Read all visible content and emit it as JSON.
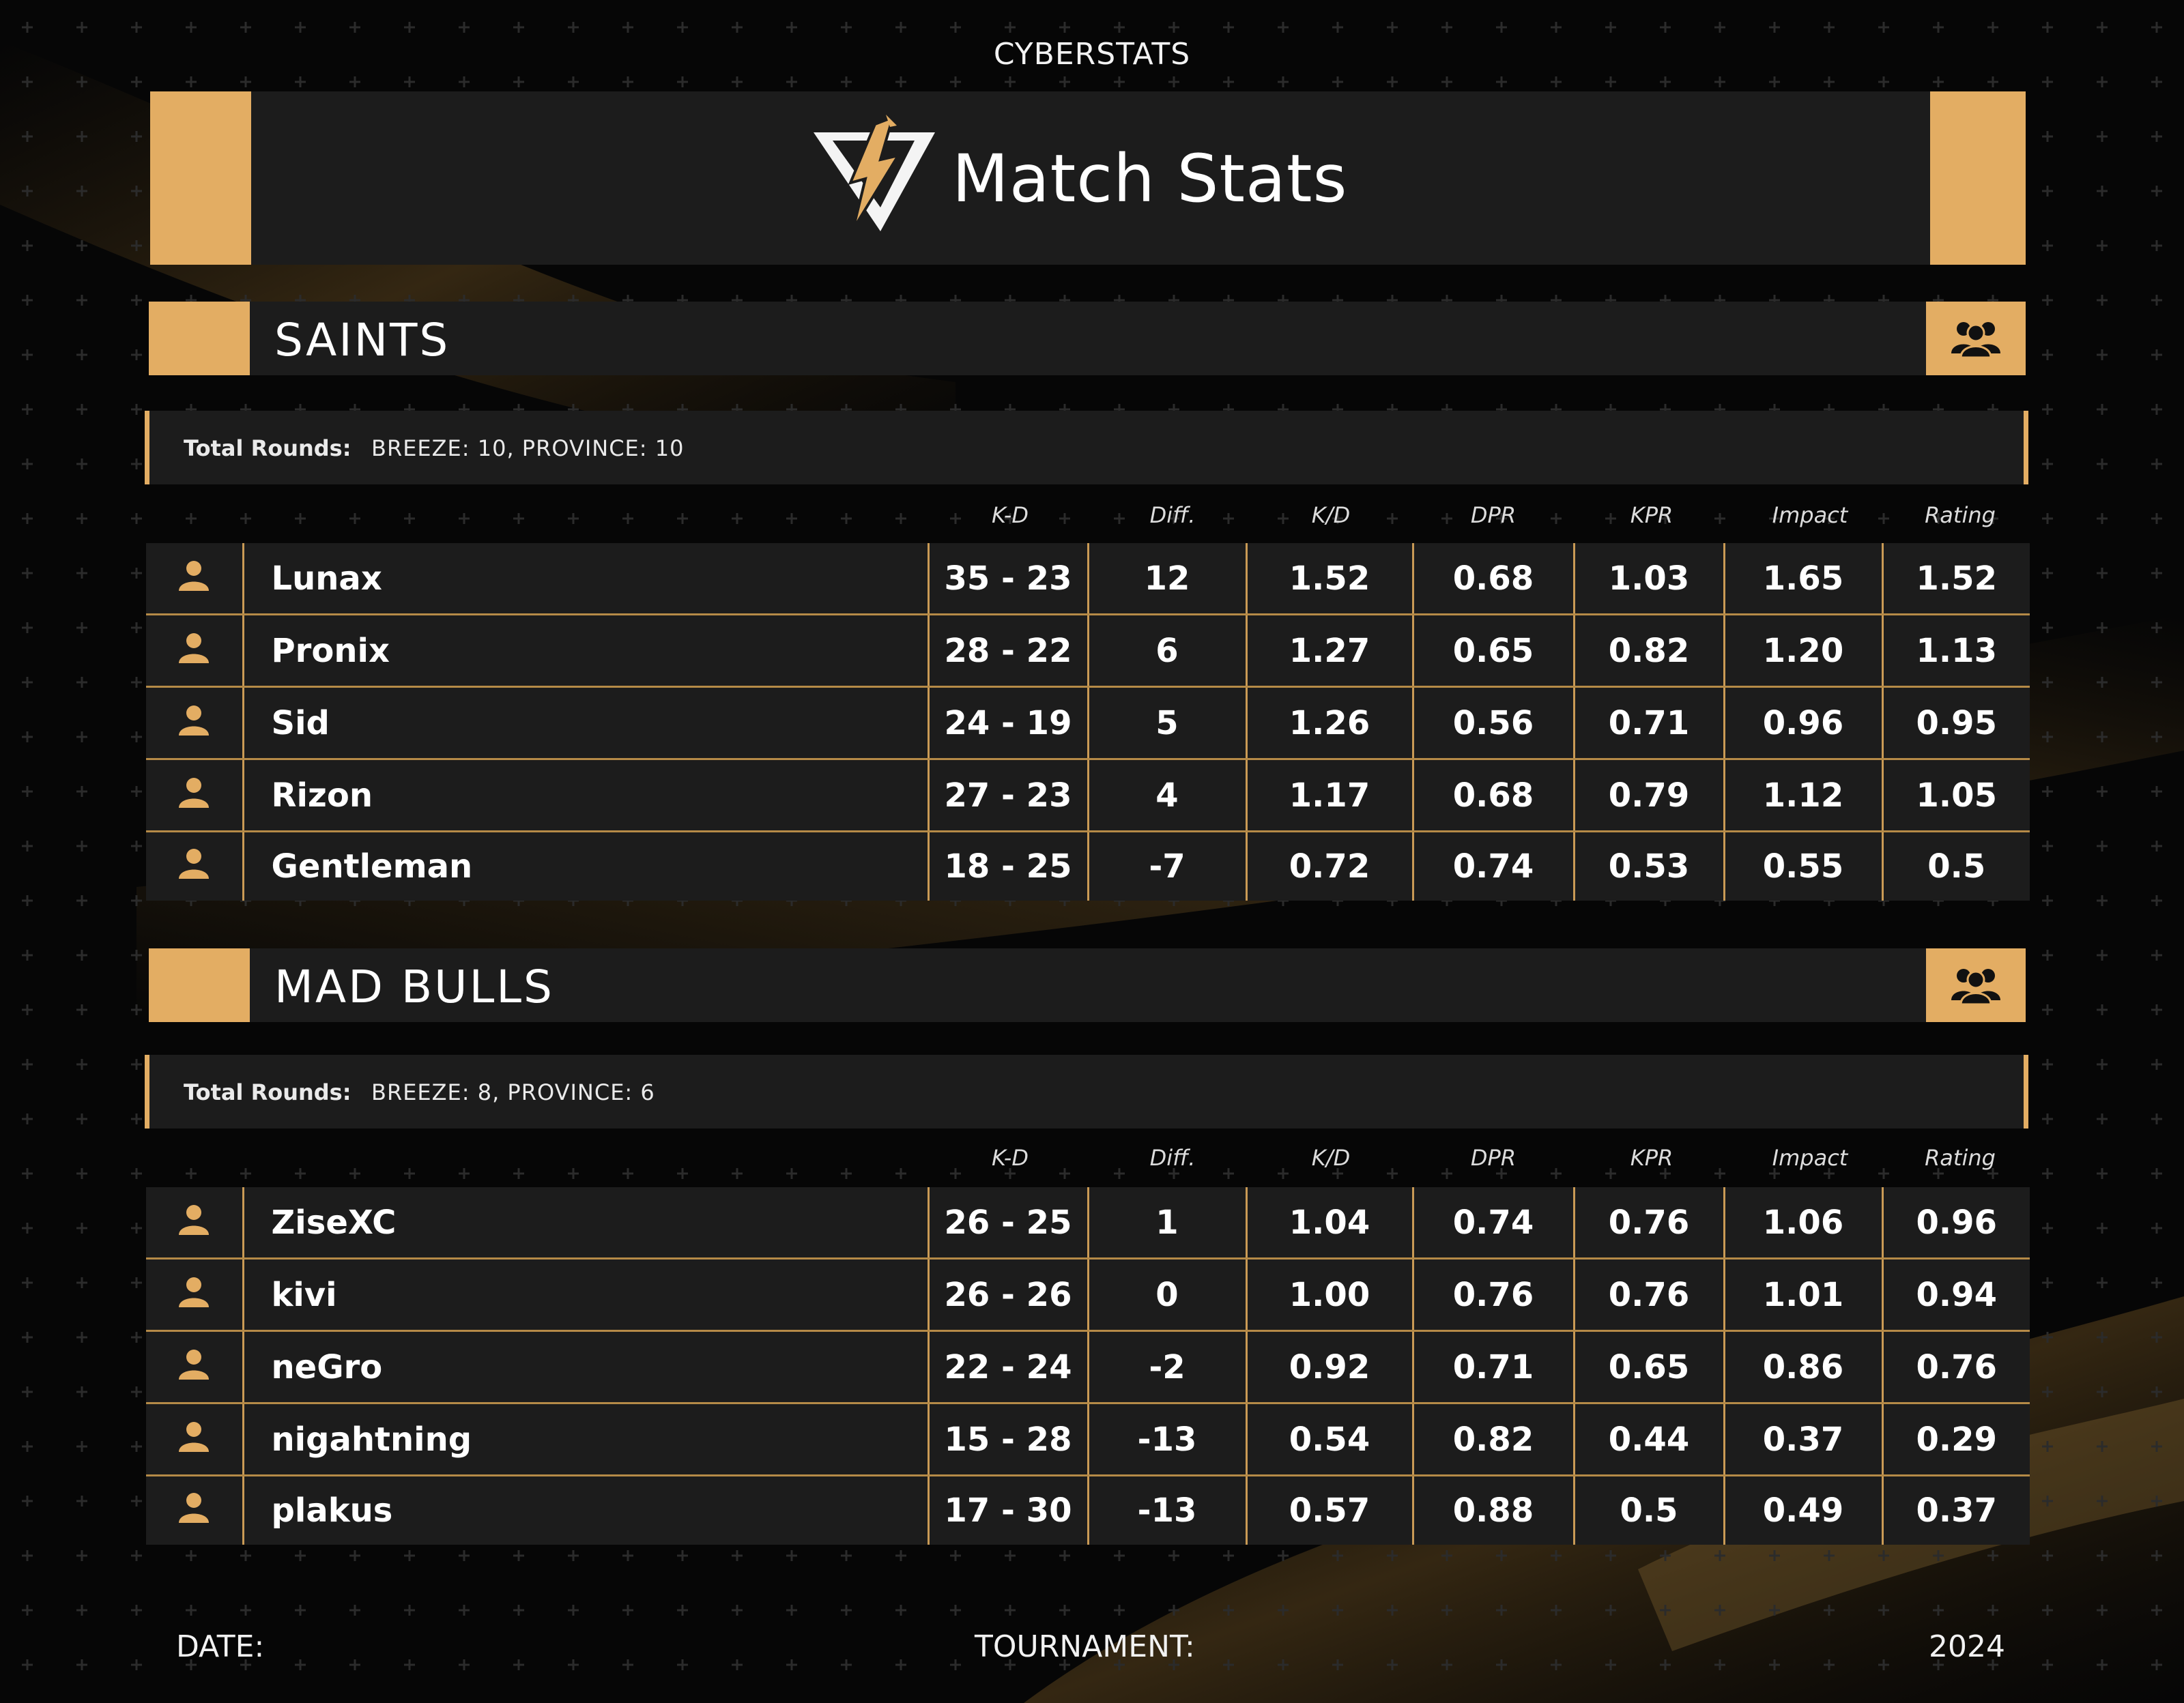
{
  "brand": "CYBERSTATS",
  "title": "Match Stats",
  "columns": [
    "K-D",
    "Diff.",
    "K/D",
    "DPR",
    "KPR",
    "Impact",
    "Rating"
  ],
  "colors": {
    "gold": "#e3ad63",
    "panel": "#1c1c1c",
    "green": "#35ef2a",
    "yellow": "#f5f20a",
    "red": "#ff2a1d"
  },
  "teams": [
    {
      "name": "SAINTS",
      "rounds_label": "Total Rounds:",
      "rounds_value": "BREEZE: 10,  PROVINCE: 10",
      "players": [
        {
          "name": "Lunax",
          "kd": "35 - 23",
          "diff": "12",
          "kdr": "1.52",
          "kdr_c": "g",
          "dpr": "0.68",
          "kpr": "1.03",
          "impact": "1.65",
          "impact_c": "g",
          "rating": "1.52"
        },
        {
          "name": "Pronix",
          "kd": "28 - 22",
          "diff": "6",
          "kdr": "1.27",
          "kdr_c": "g",
          "dpr": "0.65",
          "kpr": "0.82",
          "impact": "1.20",
          "impact_c": "g",
          "rating": "1.13"
        },
        {
          "name": "Sid",
          "kd": "24 - 19",
          "diff": "5",
          "kdr": "1.26",
          "kdr_c": "g",
          "dpr": "0.56",
          "kpr": "0.71",
          "impact": "0.96",
          "impact_c": "y",
          "rating": "0.95"
        },
        {
          "name": "Rizon",
          "kd": "27 - 23",
          "diff": "4",
          "kdr": "1.17",
          "kdr_c": "g",
          "dpr": "0.68",
          "kpr": "0.79",
          "impact": "1.12",
          "impact_c": "y",
          "rating": "1.05"
        },
        {
          "name": "Gentleman",
          "kd": "18 - 25",
          "diff": "-7",
          "kdr": "0.72",
          "kdr_c": "r",
          "dpr": "0.74",
          "kpr": "0.53",
          "impact": "0.55",
          "impact_c": "r",
          "rating": "0.5"
        }
      ]
    },
    {
      "name": "MAD BULLS",
      "rounds_label": "Total Rounds:",
      "rounds_value": "BREEZE: 8,  PROVINCE: 6",
      "players": [
        {
          "name": "ZiseXC",
          "kd": "26 - 25",
          "diff": "1",
          "kdr": "1.04",
          "kdr_c": "g",
          "dpr": "0.74",
          "kpr": "0.76",
          "impact": "1.06",
          "impact_c": "y",
          "rating": "0.96"
        },
        {
          "name": "kivi",
          "kd": "26 - 26",
          "diff": "0",
          "kdr": "1.00",
          "kdr_c": "g",
          "dpr": "0.76",
          "kpr": "0.76",
          "impact": "1.01",
          "impact_c": "y",
          "rating": "0.94"
        },
        {
          "name": "neGro",
          "kd": "22 - 24",
          "diff": "-2",
          "kdr": "0.92",
          "kdr_c": "g",
          "dpr": "0.71",
          "kpr": "0.65",
          "impact": "0.86",
          "impact_c": "r",
          "rating": "0.76"
        },
        {
          "name": "nigahtning",
          "kd": "15 - 28",
          "diff": "-13",
          "kdr": "0.54",
          "kdr_c": "r",
          "dpr": "0.82",
          "kpr": "0.44",
          "impact": "0.37",
          "impact_c": "r",
          "rating": "0.29"
        },
        {
          "name": "plakus",
          "kd": "17 - 30",
          "diff": "-13",
          "kdr": "0.57",
          "kdr_c": "r",
          "dpr": "0.88",
          "kpr": "0.5",
          "impact": "0.49",
          "impact_c": "r",
          "rating": "0.37"
        }
      ]
    }
  ],
  "footer": {
    "date_label": "DATE:",
    "tournament_label": "TOURNAMENT:",
    "year": "2024"
  },
  "icons": {
    "team": "team-icon",
    "player": "player-avatar-icon",
    "logo": "lightning-logo"
  }
}
